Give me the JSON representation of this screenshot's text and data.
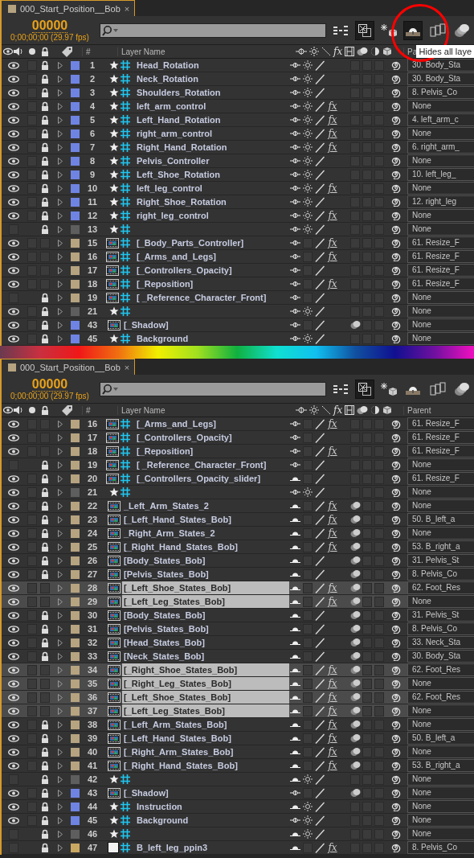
{
  "panels": [
    {
      "tab": "000_Start_Position__Bob",
      "close": "×",
      "timecode": "00000",
      "timecode_detail": "0;00;00;00 (29.97 fps)",
      "draft_3d": true,
      "hide_shy": true,
      "highlight_circle": true,
      "tooltip": "Hides all laye",
      "headers": {
        "number": "#",
        "layer_name": "Layer Name",
        "effects": "fx",
        "parent": "Pa"
      },
      "rows": [
        {
          "number": "1",
          "name": "Head_Rotation",
          "visible": true,
          "locked": true,
          "color": "#6f84e2",
          "kind": "shape",
          "shy": false,
          "collapse": true,
          "motion_blur": false,
          "parent": "30. Body_Sta",
          "selected": false
        },
        {
          "number": "2",
          "name": "Neck_Rotation",
          "visible": true,
          "locked": true,
          "color": "#6f84e2",
          "kind": "shape",
          "shy": false,
          "collapse": true,
          "motion_blur": false,
          "parent": "30. Body_Sta",
          "selected": false
        },
        {
          "number": "3",
          "name": "Shoulders_Rotation",
          "visible": true,
          "locked": true,
          "color": "#6f84e2",
          "kind": "shape",
          "shy": false,
          "collapse": true,
          "motion_blur": false,
          "parent": "8. Pelvis_Co",
          "selected": false
        },
        {
          "number": "4",
          "name": "left_arm_control",
          "visible": true,
          "locked": true,
          "color": "#6f84e2",
          "kind": "shape",
          "shy": false,
          "collapse": true,
          "effects": "fx",
          "motion_blur": false,
          "parent": "None",
          "selected": false
        },
        {
          "number": "5",
          "name": "Left_Hand_Rotation",
          "visible": true,
          "locked": true,
          "color": "#6f84e2",
          "kind": "shape",
          "shy": false,
          "collapse": true,
          "effects": "fx",
          "motion_blur": false,
          "parent": "4. left_arm_c",
          "selected": false
        },
        {
          "number": "6",
          "name": "right_arm_control",
          "visible": true,
          "locked": true,
          "color": "#6f84e2",
          "kind": "shape",
          "shy": false,
          "collapse": true,
          "effects": "fx",
          "motion_blur": false,
          "parent": "None",
          "selected": false
        },
        {
          "number": "7",
          "name": "Right_Hand_Rotation",
          "visible": true,
          "locked": true,
          "color": "#6f84e2",
          "kind": "shape",
          "shy": false,
          "collapse": true,
          "effects": "fx",
          "motion_blur": false,
          "parent": "6. right_arm_",
          "selected": false
        },
        {
          "number": "8",
          "name": "Pelvis_Controller",
          "visible": true,
          "locked": true,
          "color": "#6f84e2",
          "kind": "shape",
          "shy": false,
          "collapse": true,
          "motion_blur": false,
          "parent": "None",
          "selected": false
        },
        {
          "number": "9",
          "name": "Left_Shoe_Rotation",
          "visible": true,
          "locked": true,
          "color": "#6f84e2",
          "kind": "shape",
          "shy": false,
          "collapse": true,
          "motion_blur": false,
          "parent": "10. left_leg_",
          "selected": false
        },
        {
          "number": "10",
          "name": "left_leg_control",
          "visible": true,
          "locked": true,
          "color": "#6f84e2",
          "kind": "shape",
          "shy": false,
          "collapse": true,
          "effects": "fx",
          "motion_blur": false,
          "parent": "None",
          "selected": false
        },
        {
          "number": "11",
          "name": "Right_Shoe_Rotation",
          "visible": true,
          "locked": true,
          "color": "#6f84e2",
          "kind": "shape",
          "shy": false,
          "collapse": true,
          "motion_blur": false,
          "parent": "12. right_leg",
          "selected": false
        },
        {
          "number": "12",
          "name": "right_leg_control",
          "visible": true,
          "locked": true,
          "color": "#6f84e2",
          "kind": "shape",
          "shy": false,
          "collapse": true,
          "effects": "fx",
          "motion_blur": false,
          "parent": "None",
          "selected": false
        },
        {
          "number": "13",
          "visible": false,
          "locked": true,
          "color": "#5e5e5e",
          "kind": "shape",
          "shy": false,
          "collapse": true,
          "motion_blur": false,
          "parent": "None",
          "selected": false
        },
        {
          "number": "15",
          "name": "[_Body_Parts_Controller]",
          "visible": true,
          "locked": false,
          "color": "#b6a380",
          "kind": "comp_grid",
          "shy": false,
          "collapse": false,
          "effects": "fx",
          "motion_blur": false,
          "parent": "61. Resize_F",
          "selected": false
        },
        {
          "number": "16",
          "name": "[_Arms_and_Legs]",
          "visible": true,
          "locked": false,
          "color": "#b6a380",
          "kind": "comp_grid",
          "shy": false,
          "collapse": false,
          "effects": "fx",
          "motion_blur": false,
          "parent": "61. Resize_F",
          "selected": false
        },
        {
          "number": "17",
          "name": "[_Controllers_Opacity]",
          "visible": true,
          "locked": false,
          "color": "#b6a380",
          "kind": "comp_grid",
          "shy": false,
          "collapse": false,
          "motion_blur": false,
          "parent": "61. Resize_F",
          "selected": false
        },
        {
          "number": "18",
          "name": "[_Reposition]",
          "visible": true,
          "locked": false,
          "color": "#b6a380",
          "kind": "comp_grid",
          "shy": false,
          "collapse": false,
          "effects": "fx",
          "motion_blur": false,
          "parent": "61. Resize_F",
          "selected": false
        },
        {
          "number": "19",
          "name": "[ _Reference_Character_Front]",
          "visible": false,
          "locked": true,
          "color": "#b6a380",
          "kind": "comp_grid",
          "shy": false,
          "collapse": false,
          "motion_blur": false,
          "parent": "None",
          "selected": false
        },
        {
          "number": "21",
          "visible": true,
          "locked": true,
          "color": "#5e5e5e",
          "kind": "shape",
          "shy": false,
          "collapse": true,
          "motion_blur": false,
          "parent": "None",
          "selected": false
        },
        {
          "number": "43",
          "name": "[_Shadow]",
          "visible": true,
          "locked": true,
          "color": "#6f84e2",
          "kind": "comp",
          "shy": false,
          "collapse": false,
          "motion_blur": true,
          "parent": "None",
          "selected": false
        },
        {
          "number": "45",
          "name": "Background",
          "visible": true,
          "locked": true,
          "color": "#6f84e2",
          "kind": "shape",
          "shy": false,
          "collapse": true,
          "motion_blur": false,
          "parent": "None",
          "selected": false
        }
      ]
    },
    {
      "tab": "000_Start_Position__Bob",
      "close": "×",
      "timecode": "00000",
      "timecode_detail": "0;00;00;00 (29.97 fps)",
      "draft_3d": true,
      "hide_shy": false,
      "highlight_circle": false,
      "headers": {
        "number": "#",
        "layer_name": "Layer Name",
        "effects": "fx",
        "parent": "Parent"
      },
      "rows": [
        {
          "number": "16",
          "name": "[_Arms_and_Legs]",
          "visible": true,
          "locked": false,
          "color": "#b6a380",
          "kind": "comp_grid",
          "shy": false,
          "collapse": false,
          "effects": "fx",
          "motion_blur": false,
          "parent": "61. Resize_F",
          "selected": false
        },
        {
          "number": "17",
          "name": "[_Controllers_Opacity]",
          "visible": true,
          "locked": false,
          "color": "#b6a380",
          "kind": "comp_grid",
          "shy": false,
          "collapse": false,
          "motion_blur": false,
          "parent": "61. Resize_F",
          "selected": false
        },
        {
          "number": "18",
          "name": "[_Reposition]",
          "visible": true,
          "locked": false,
          "color": "#b6a380",
          "kind": "comp_grid",
          "shy": false,
          "collapse": false,
          "effects": "fx",
          "motion_blur": false,
          "parent": "61. Resize_F",
          "selected": false
        },
        {
          "number": "19",
          "name": "[ _Reference_Character_Front]",
          "visible": false,
          "locked": true,
          "color": "#b6a380",
          "kind": "comp_grid",
          "shy": false,
          "collapse": false,
          "motion_blur": false,
          "parent": "None",
          "selected": false
        },
        {
          "number": "20",
          "name": "[_Controllers_Opacity_slider]",
          "visible": true,
          "locked": true,
          "color": "#b6a380",
          "kind": "comp_grid",
          "shy": true,
          "collapse": false,
          "motion_blur": false,
          "parent": "61. Resize_F",
          "selected": false
        },
        {
          "number": "21",
          "visible": true,
          "locked": true,
          "color": "#5e5e5e",
          "kind": "shape",
          "shy": false,
          "collapse": true,
          "motion_blur": false,
          "parent": "None",
          "selected": false
        },
        {
          "number": "22",
          "name": "_Left_Arm_States_2",
          "visible": true,
          "locked": true,
          "color": "#b6a380",
          "kind": "comp",
          "shy": true,
          "collapse": false,
          "effects": "fx",
          "motion_blur": true,
          "parent": "None",
          "selected": false
        },
        {
          "number": "23",
          "name": "[_Left_Hand_States_Bob]",
          "visible": true,
          "locked": true,
          "color": "#b6a380",
          "kind": "comp",
          "shy": true,
          "collapse": false,
          "effects": "fx",
          "motion_blur": true,
          "parent": "50. B_left_a",
          "selected": false
        },
        {
          "number": "24",
          "name": "_Right_Arm_States_2",
          "visible": true,
          "locked": true,
          "color": "#b6a380",
          "kind": "comp",
          "shy": true,
          "collapse": false,
          "effects": "fx",
          "motion_blur": true,
          "parent": "None",
          "selected": false
        },
        {
          "number": "25",
          "name": "[_Right_Hand_States_Bob]",
          "visible": true,
          "locked": true,
          "color": "#b6a380",
          "kind": "comp",
          "shy": true,
          "collapse": false,
          "effects": "fx",
          "motion_blur": true,
          "parent": "53. B_right_a",
          "selected": false
        },
        {
          "number": "26",
          "name": "[Body_States_Bob]",
          "visible": true,
          "locked": true,
          "color": "#b6a380",
          "kind": "comp",
          "shy": true,
          "collapse": false,
          "motion_blur": true,
          "parent": "31. Pelvis_St",
          "selected": false
        },
        {
          "number": "27",
          "name": "[Pelvis_States_Bob]",
          "visible": true,
          "locked": true,
          "color": "#b6a380",
          "kind": "comp",
          "shy": true,
          "collapse": false,
          "motion_blur": true,
          "parent": "8. Pelvis_Co",
          "selected": false
        },
        {
          "number": "28",
          "name": "[_Left_Shoe_States_Bob]",
          "visible": true,
          "locked": false,
          "color": "#b6a380",
          "kind": "comp",
          "shy": true,
          "collapse": false,
          "effects": "fx",
          "motion_blur": true,
          "parent": "62. Foot_Res",
          "selected": true
        },
        {
          "number": "29",
          "name": "[_Left_Leg_States_Bob]",
          "visible": true,
          "locked": false,
          "color": "#b6a380",
          "kind": "comp",
          "shy": true,
          "collapse": false,
          "effects": "fx",
          "motion_blur": true,
          "parent": "None",
          "selected": true
        },
        {
          "number": "30",
          "name": "[Body_States_Bob]",
          "visible": true,
          "locked": true,
          "color": "#b6a380",
          "kind": "comp",
          "shy": true,
          "collapse": false,
          "motion_blur": true,
          "parent": "31. Pelvis_St",
          "selected": false
        },
        {
          "number": "31",
          "name": "[Pelvis_States_Bob]",
          "visible": true,
          "locked": true,
          "color": "#b6a380",
          "kind": "comp",
          "shy": true,
          "collapse": false,
          "motion_blur": true,
          "parent": "8. Pelvis_Co",
          "selected": false
        },
        {
          "number": "32",
          "name": "[Head_States_Bob]",
          "visible": true,
          "locked": true,
          "color": "#b6a380",
          "kind": "comp",
          "shy": true,
          "collapse": false,
          "motion_blur": true,
          "parent": "33. Neck_Sta",
          "selected": false
        },
        {
          "number": "33",
          "name": "[Neck_States_Bob]",
          "visible": true,
          "locked": true,
          "color": "#b6a380",
          "kind": "comp",
          "shy": true,
          "collapse": false,
          "motion_blur": true,
          "parent": "30. Body_Sta",
          "selected": false
        },
        {
          "number": "34",
          "name": "[_Right_Shoe_States_Bob]",
          "visible": true,
          "locked": false,
          "color": "#b6a380",
          "kind": "comp",
          "shy": true,
          "collapse": false,
          "effects": "fx",
          "motion_blur": true,
          "parent": "62. Foot_Res",
          "selected": true
        },
        {
          "number": "35",
          "name": "[_Right_Leg_States_Bob]",
          "visible": true,
          "locked": false,
          "color": "#b6a380",
          "kind": "comp",
          "shy": true,
          "collapse": false,
          "effects": "fx",
          "motion_blur": true,
          "parent": "None",
          "selected": true
        },
        {
          "number": "36",
          "name": "[_Left_Shoe_States_Bob]",
          "visible": true,
          "locked": false,
          "color": "#b6a380",
          "kind": "comp",
          "shy": true,
          "collapse": false,
          "effects": "fx",
          "motion_blur": true,
          "parent": "62. Foot_Res",
          "selected": true
        },
        {
          "number": "37",
          "name": "[_Left_Leg_States_Bob]",
          "visible": true,
          "locked": false,
          "color": "#b6a380",
          "kind": "comp",
          "shy": true,
          "collapse": false,
          "effects": "fx",
          "motion_blur": true,
          "parent": "None",
          "selected": true
        },
        {
          "number": "38",
          "name": "[_Left_Arm_States_Bob]",
          "visible": true,
          "locked": true,
          "color": "#b6a380",
          "kind": "comp",
          "shy": true,
          "collapse": false,
          "effects": "fx",
          "motion_blur": true,
          "parent": "None",
          "selected": false
        },
        {
          "number": "39",
          "name": "[_Left_Hand_States_Bob]",
          "visible": true,
          "locked": true,
          "color": "#b6a380",
          "kind": "comp",
          "shy": true,
          "collapse": false,
          "effects": "fx",
          "motion_blur": true,
          "parent": "50. B_left_a",
          "selected": false
        },
        {
          "number": "40",
          "name": "[_Right_Arm_States_Bob]",
          "visible": true,
          "locked": true,
          "color": "#b6a380",
          "kind": "comp",
          "shy": true,
          "collapse": false,
          "effects": "fx",
          "motion_blur": true,
          "parent": "None",
          "selected": false
        },
        {
          "number": "41",
          "name": "[_Right_Hand_States_Bob]",
          "visible": true,
          "locked": true,
          "color": "#b6a380",
          "kind": "comp",
          "shy": true,
          "collapse": false,
          "effects": "fx",
          "motion_blur": true,
          "parent": "53. B_right_a",
          "selected": false
        },
        {
          "number": "42",
          "visible": false,
          "locked": true,
          "color": "#5e5e5e",
          "kind": "shape",
          "shy": true,
          "collapse": true,
          "motion_blur": false,
          "parent": "None",
          "selected": false
        },
        {
          "number": "43",
          "name": "[_Shadow]",
          "visible": true,
          "locked": true,
          "color": "#6f84e2",
          "kind": "comp",
          "shy": false,
          "collapse": false,
          "motion_blur": true,
          "parent": "None",
          "selected": false
        },
        {
          "number": "44",
          "name": "Instruction",
          "visible": true,
          "locked": true,
          "color": "#6f84e2",
          "kind": "shape",
          "shy": true,
          "collapse": true,
          "motion_blur": false,
          "parent": "None",
          "selected": false
        },
        {
          "number": "45",
          "name": "Background",
          "visible": true,
          "locked": true,
          "color": "#6f84e2",
          "kind": "shape",
          "shy": false,
          "collapse": true,
          "motion_blur": false,
          "parent": "None",
          "selected": false
        },
        {
          "number": "46",
          "visible": false,
          "locked": true,
          "color": "#5e5e5e",
          "kind": "shape",
          "shy": true,
          "collapse": true,
          "motion_blur": false,
          "parent": "None",
          "selected": false
        },
        {
          "number": "47",
          "name": "B_left_leg_ppin3",
          "visible": false,
          "locked": true,
          "color": "#c9a862",
          "kind": "solid",
          "shy": true,
          "collapse": false,
          "effects": "fx",
          "motion_blur": false,
          "parent": "8. Pelvis_Co",
          "selected": false
        }
      ]
    }
  ]
}
